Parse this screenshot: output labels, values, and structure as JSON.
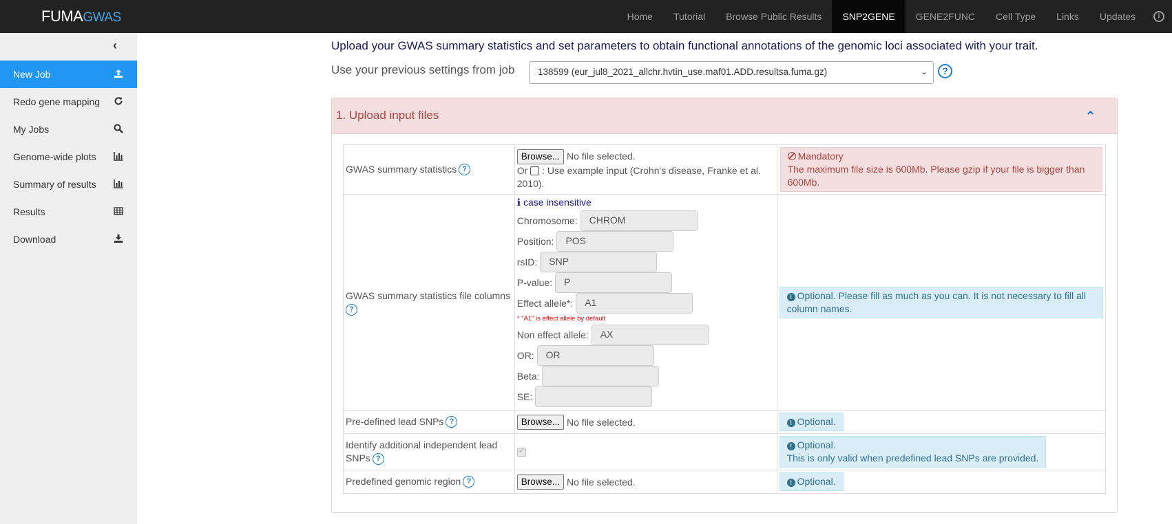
{
  "brand": {
    "part1": "FUMA",
    "part2": "GWAS"
  },
  "nav": {
    "items": [
      "Home",
      "Tutorial",
      "Browse Public Results",
      "SNP2GENE",
      "GENE2FUNC",
      "Cell Type",
      "Links",
      "Updates"
    ],
    "active": "SNP2GENE",
    "icon": "info-icon"
  },
  "sidebar": {
    "collapse_icon": "chevron-left-icon",
    "items": [
      {
        "label": "New Job",
        "icon": "upload-icon",
        "active": true
      },
      {
        "label": "Redo gene mapping",
        "icon": "refresh-icon"
      },
      {
        "label": "My Jobs",
        "icon": "search-icon"
      },
      {
        "label": "Genome-wide plots",
        "icon": "bar-chart-icon"
      },
      {
        "label": "Summary of results",
        "icon": "bar-chart-icon"
      },
      {
        "label": "Results",
        "icon": "table-icon"
      },
      {
        "label": "Download",
        "icon": "download-icon"
      }
    ]
  },
  "main": {
    "intro": "Upload your GWAS summary statistics and set parameters to obtain functional annotations of the genomic loci associated with your trait.",
    "prev_label": "Use your previous settings from job",
    "prev_value": "138599 (eur_jul8_2021_allchr.hvtin_use.maf01.ADD.resultsa.fuma.gz)",
    "panel_title": "1. Upload input files"
  },
  "form": {
    "browse_label": "Browse...",
    "no_file": "No file selected.",
    "gwas": {
      "label": "GWAS summary statistics",
      "or": "Or",
      "example": ": Use example input (Crohn's disease, Franke et al. 2010).",
      "mandatory": "Mandatory",
      "mandatory_text": "The maximum file size is 600Mb. Please gzip if your file is bigger than 600Mb."
    },
    "columns": {
      "label": "GWAS summary statistics file columns",
      "info": "case insensitive",
      "note": "* \"A1\" is effect allele by default",
      "optional_text": "Optional. Please fill as much as you can. It is not necessary to fill all column names.",
      "fields": [
        {
          "label": "Chromosome:",
          "value": "CHROM"
        },
        {
          "label": "Position:",
          "value": "POS"
        },
        {
          "label": "rsID:",
          "value": "SNP"
        },
        {
          "label": "P-value:",
          "value": "P"
        },
        {
          "label": "Effect allele*:",
          "value": "A1"
        },
        {
          "label": "Non effect allele:",
          "value": "AX"
        },
        {
          "label": "OR:",
          "value": "OR"
        },
        {
          "label": "Beta:",
          "value": ""
        },
        {
          "label": "SE:",
          "value": ""
        }
      ]
    },
    "lead": {
      "label": "Pre-defined lead SNPs",
      "optional": "Optional."
    },
    "additional": {
      "label": "Identify additional independent lead SNPs",
      "optional": "Optional.",
      "note": "This is only valid when predefined lead SNPs are provided."
    },
    "region": {
      "label": "Predefined genomic region",
      "optional": "Optional."
    }
  }
}
